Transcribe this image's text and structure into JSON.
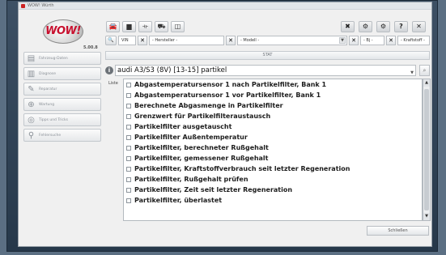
{
  "app": {
    "title_bar": "WOW! Würth",
    "logo_text": "WOW!",
    "version": "5.00.8"
  },
  "toolbar": {
    "icons": [
      "car-icon",
      "truck-icon",
      "motorcycle-icon",
      "tractor-icon",
      "manual-icon"
    ],
    "right_icons": [
      "close-x-icon",
      "tools-icon",
      "settings-icon",
      "help-icon",
      "exit-icon"
    ],
    "right_glyphs": [
      "✖",
      "⚙",
      "⚙",
      "?",
      "✕"
    ],
    "vin_label": "VIN",
    "hersteller": "- Hersteller -",
    "modell": "- Modell -",
    "bj": "- Bj -",
    "kraftstoff": "- Kraftstoff -"
  },
  "sidebar": {
    "items": [
      {
        "label": "Fahrzeug-Daten",
        "icon": "car-data-icon",
        "glyph": "▤"
      },
      {
        "label": "Diagnose",
        "icon": "diagnosis-icon",
        "glyph": "▥"
      },
      {
        "label": "Reparatur",
        "icon": "wrench-icon",
        "glyph": "✎"
      },
      {
        "label": "Wartung",
        "icon": "service-icon",
        "glyph": "⊕"
      },
      {
        "label": "Tipps und Tricks",
        "icon": "tips-icon",
        "glyph": "◎"
      },
      {
        "label": "Fehlersuche",
        "icon": "troubleshoot-icon",
        "glyph": "⚲"
      }
    ]
  },
  "main": {
    "header": "STAT",
    "info_glyph": "i",
    "vehicle": "audi A3/S3 (8V) [13-15] partikel",
    "list_label": "Liste",
    "items": [
      "Abgastemperatursensor 1 nach Partikelfilter, Bank 1",
      "Abgastemperatursensor 1 vor Partikelfilter, Bank 1",
      "Berechnete Abgasmenge in Partikelfilter",
      "Grenzwert für Partikelfilteraustausch",
      "Partikelfilter ausgetauscht",
      "Partikelfilter Außentemperatur",
      "Partikelfilter, berechneter Rußgehalt",
      "Partikelfilter, gemessener Rußgehalt",
      "Partikelfilter, Kraftstoffverbrauch seit letzter Regeneration",
      "Partikelfilter, Rußgehalt prüfen",
      "Partikelfilter, Zeit seit letzter Regeneration",
      "Partikelfilter, überlastet"
    ],
    "close_label": "Schließen"
  },
  "colors": {
    "accent": "#c8102e",
    "background": "#f0f0f0"
  }
}
